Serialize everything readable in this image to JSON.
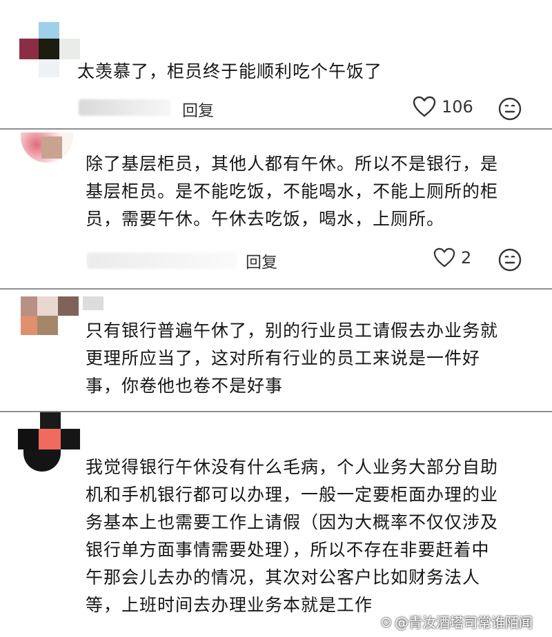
{
  "comments": [
    {
      "text": "太羡慕了，柜员终于能顺利吃个午饭了",
      "reply_label": "回复",
      "likes": "106",
      "name_blur_text": "别北京"
    },
    {
      "text": "除了基层柜员，其他人都有午休。所以不是银行，是\n基层柜员。是不能吃饭，不能喝水，不能上厕所的柜\n员，需要午休。午休去吃饭，喝水，上厕所。",
      "reply_label": "回复",
      "likes": "2"
    },
    {
      "text": "只有银行普遍午休了，别的行业员工请假去办业务就\n更理所应当了，这对所有行业的员工来说是一件好\n事，你卷他也卷不是好事"
    },
    {
      "text": "我觉得银行午休没有什么毛病，个人业务大部分自助\n机和手机银行都可以办理，一般一定要柜面办理的业\n务基本上也需要工作上请假（因为大概率不仅仅涉及\n银行单方面事情需要处理），所以不存在非要赶着中\n午那会儿去办的情况，其次对公客户比如财务法人\n等，上班时间去办理业务本就是工作"
    }
  ],
  "watermark": "@青汝酒塔司常谁陌闻",
  "icons": {
    "like": "heart-outline-icon",
    "emoji": "emoji-face-icon"
  }
}
